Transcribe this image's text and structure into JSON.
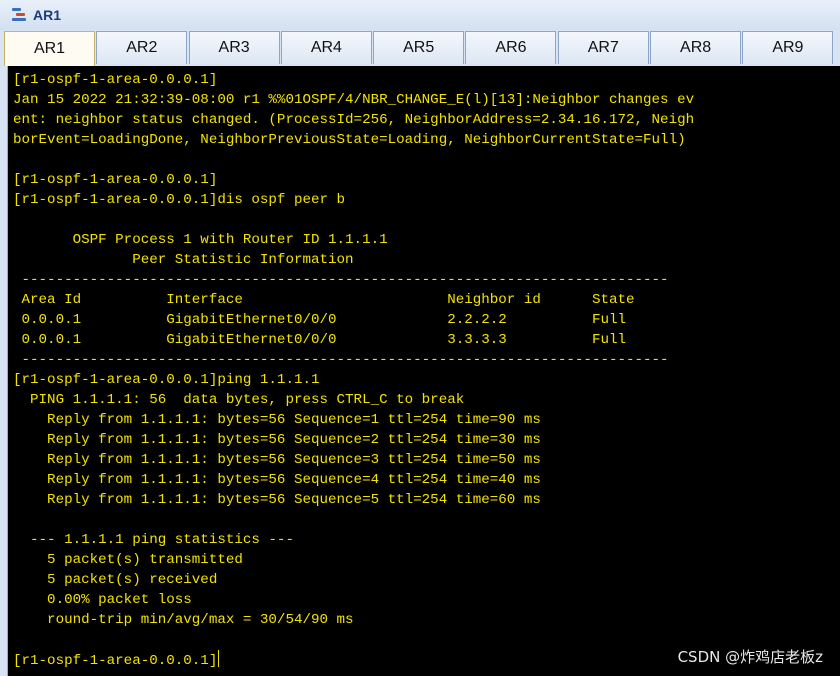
{
  "window": {
    "title": "AR1",
    "icon": "router-app-icon"
  },
  "tabs": [
    {
      "label": "AR1",
      "active": true
    },
    {
      "label": "AR2",
      "active": false
    },
    {
      "label": "AR3",
      "active": false
    },
    {
      "label": "AR4",
      "active": false
    },
    {
      "label": "AR5",
      "active": false
    },
    {
      "label": "AR6",
      "active": false
    },
    {
      "label": "AR7",
      "active": false
    },
    {
      "label": "AR8",
      "active": false
    },
    {
      "label": "AR9",
      "active": false
    }
  ],
  "terminal": {
    "colors": {
      "background": "#000000",
      "text": "#f2e300"
    },
    "lines": [
      "[r1-ospf-1-area-0.0.0.1]",
      "Jan 15 2022 21:32:39-08:00 r1 %%01OSPF/4/NBR_CHANGE_E(l)[13]:Neighbor changes ev",
      "ent: neighbor status changed. (ProcessId=256, NeighborAddress=2.34.16.172, Neigh",
      "borEvent=LoadingDone, NeighborPreviousState=Loading, NeighborCurrentState=Full)",
      "",
      "[r1-ospf-1-area-0.0.0.1]",
      "[r1-ospf-1-area-0.0.0.1]dis ospf peer b",
      "",
      "       OSPF Process 1 with Router ID 1.1.1.1",
      "              Peer Statistic Information",
      " ----------------------------------------------------------------------------",
      " Area Id          Interface                        Neighbor id      State",
      " 0.0.0.1          GigabitEthernet0/0/0             2.2.2.2          Full",
      " 0.0.0.1          GigabitEthernet0/0/0             3.3.3.3          Full",
      " ----------------------------------------------------------------------------",
      "[r1-ospf-1-area-0.0.0.1]ping 1.1.1.1",
      "  PING 1.1.1.1: 56  data bytes, press CTRL_C to break",
      "    Reply from 1.1.1.1: bytes=56 Sequence=1 ttl=254 time=90 ms",
      "    Reply from 1.1.1.1: bytes=56 Sequence=2 ttl=254 time=30 ms",
      "    Reply from 1.1.1.1: bytes=56 Sequence=3 ttl=254 time=50 ms",
      "    Reply from 1.1.1.1: bytes=56 Sequence=4 ttl=254 time=40 ms",
      "    Reply from 1.1.1.1: bytes=56 Sequence=5 ttl=254 time=60 ms",
      "",
      "  --- 1.1.1.1 ping statistics ---",
      "    5 packet(s) transmitted",
      "    5 packet(s) received",
      "    0.00% packet loss",
      "    round-trip min/avg/max = 30/54/90 ms",
      "",
      "[r1-ospf-1-area-0.0.0.1]"
    ]
  },
  "watermark": "CSDN @炸鸡店老板z"
}
